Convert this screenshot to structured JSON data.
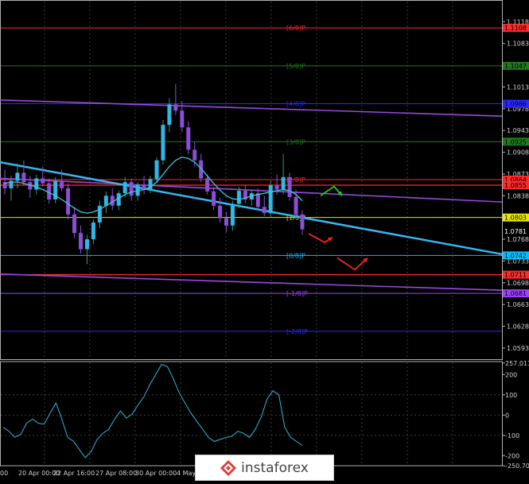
{
  "chart_data": [
    {
      "type": "candlestick",
      "ylim": [
        1.0575,
        1.1135
      ],
      "y_ticks": [
        "1.1118",
        "1.1083",
        "1.1048",
        "1.1013",
        "1.0978",
        "1.0943",
        "1.0908",
        "1.0873",
        "1.0838",
        "1.0803",
        "1.0768",
        "1.0733",
        "1.0698",
        "1.0663",
        "1.0628",
        "1.0593"
      ],
      "x_ticks": [
        "00",
        "20 Apr 00:00",
        "22 Apr 16:00",
        "27 Apr 08:00",
        "30 Apr 00:00",
        "4 May"
      ],
      "murray_levels": [
        {
          "label": "[6/8]P",
          "value": 1.1108,
          "tag": "1.1108",
          "color": "#ff2a2a"
        },
        {
          "label": "[5/8]P",
          "value": 1.1047,
          "tag": "1.1047",
          "color": "#1f7a1f"
        },
        {
          "label": "[4/8]P",
          "value": 1.0986,
          "tag": "1.0986",
          "color": "#2a2aff"
        },
        {
          "label": "[3/8]P",
          "value": 1.0925,
          "tag": "1.0925",
          "color": "#1f7a1f"
        },
        {
          "label": "[2/8]P",
          "value": 1.0864,
          "tag": "1.0864",
          "color": "#ff2a2a"
        },
        {
          "label": "[1/8]P",
          "value": 1.0803,
          "tag": "1.0803",
          "color": "#e8e800"
        },
        {
          "label": "[0/8]P",
          "value": 1.0742,
          "tag": "1.0742",
          "color": "#00bfff"
        },
        {
          "label": "[-1/8]P",
          "value": 1.0681,
          "tag": "1.0681",
          "color": "#a040ff"
        },
        {
          "label": "[-2/8]P",
          "value": 1.062,
          "tag": "",
          "color": "#2a2aff"
        }
      ],
      "price_tags": [
        {
          "value": 1.0855,
          "tag": "1.0855",
          "color": "#ff2a2a"
        },
        {
          "value": 1.0781,
          "tag": "1.0781",
          "color": "#ffffff"
        },
        {
          "value": 1.0711,
          "tag": "1.0711",
          "color": "#ff2a2a"
        }
      ],
      "current_price": 1.0781,
      "candles": [
        [
          1.086,
          1.088,
          1.084,
          1.085
        ],
        [
          1.085,
          1.087,
          1.083,
          1.0862
        ],
        [
          1.0862,
          1.089,
          1.085,
          1.0875
        ],
        [
          1.0875,
          1.0895,
          1.0855,
          1.086
        ],
        [
          1.086,
          1.087,
          1.0835,
          1.0848
        ],
        [
          1.0848,
          1.0872,
          1.084,
          1.0866
        ],
        [
          1.0866,
          1.0885,
          1.0852,
          1.0858
        ],
        [
          1.0858,
          1.0866,
          1.0825,
          1.0832
        ],
        [
          1.0832,
          1.0868,
          1.0826,
          1.0862
        ],
        [
          1.0862,
          1.088,
          1.0845,
          1.085
        ],
        [
          1.085,
          1.0858,
          1.08,
          1.0808
        ],
        [
          1.0808,
          1.082,
          1.077,
          1.0778
        ],
        [
          1.0778,
          1.079,
          1.0745,
          1.0752
        ],
        [
          1.0752,
          1.0775,
          1.0728,
          1.0768
        ],
        [
          1.0768,
          1.08,
          1.076,
          1.0795
        ],
        [
          1.0795,
          1.083,
          1.0786,
          1.0822
        ],
        [
          1.0822,
          1.0845,
          1.081,
          1.0838
        ],
        [
          1.0838,
          1.085,
          1.0815,
          1.0822
        ],
        [
          1.0822,
          1.0846,
          1.0815,
          1.0842
        ],
        [
          1.0842,
          1.0868,
          1.0835,
          1.086
        ],
        [
          1.086,
          1.0866,
          1.083,
          1.0838
        ],
        [
          1.0838,
          1.086,
          1.083,
          1.0856
        ],
        [
          1.0856,
          1.087,
          1.084,
          1.0848
        ],
        [
          1.0848,
          1.087,
          1.0842,
          1.0865
        ],
        [
          1.0865,
          1.09,
          1.0858,
          1.0895
        ],
        [
          1.0895,
          1.096,
          1.0888,
          1.0952
        ],
        [
          1.0952,
          1.0995,
          1.094,
          1.0985
        ],
        [
          1.0985,
          1.1018,
          1.0968,
          1.0975
        ],
        [
          1.0975,
          1.099,
          1.094,
          1.0948
        ],
        [
          1.0948,
          1.0958,
          1.0905,
          1.0912
        ],
        [
          1.0912,
          1.0925,
          1.0885,
          1.0895
        ],
        [
          1.0895,
          1.0905,
          1.086,
          1.0866
        ],
        [
          1.0866,
          1.0872,
          1.084,
          1.0845
        ],
        [
          1.0845,
          1.0852,
          1.0815,
          1.0822
        ],
        [
          1.0822,
          1.0835,
          1.0795,
          1.0802
        ],
        [
          1.0802,
          1.0812,
          1.078,
          1.079
        ],
        [
          1.079,
          1.083,
          1.0782,
          1.0825
        ],
        [
          1.0825,
          1.0852,
          1.0818,
          1.0846
        ],
        [
          1.0846,
          1.0856,
          1.0826,
          1.0832
        ],
        [
          1.0832,
          1.0848,
          1.0822,
          1.0842
        ],
        [
          1.0842,
          1.085,
          1.0815,
          1.082
        ],
        [
          1.082,
          1.0838,
          1.0805,
          1.081
        ],
        [
          1.081,
          1.0862,
          1.0805,
          1.0855
        ],
        [
          1.0855,
          1.0872,
          1.084,
          1.0848
        ],
        [
          1.0848,
          1.0905,
          1.084,
          1.0868
        ],
        [
          1.0868,
          1.0875,
          1.083,
          1.0836
        ],
        [
          1.0836,
          1.0848,
          1.08,
          1.0808
        ],
        [
          1.0808,
          1.0815,
          1.0775,
          1.0784
        ]
      ],
      "ma": [
        1.0858,
        1.086,
        1.086,
        1.0858,
        1.0855,
        1.0852,
        1.0848,
        1.0843,
        1.0838,
        1.0832,
        1.0825,
        1.0818,
        1.0812,
        1.081,
        1.0812,
        1.0816,
        1.0822,
        1.0828,
        1.0834,
        1.084,
        1.0844,
        1.0846,
        1.0848,
        1.0852,
        1.086,
        1.0872,
        1.0885,
        1.0895,
        1.09,
        1.0898,
        1.0892,
        1.0882,
        1.087,
        1.0858,
        1.0847,
        1.0838,
        1.0833,
        1.0832,
        1.0834,
        1.0838,
        1.084,
        1.0842,
        1.0844,
        1.0846,
        1.0848,
        1.0846,
        1.084,
        1.083
      ],
      "trend_lines": [
        {
          "name": "regression-upper",
          "color": "#9a48e0",
          "from": [
            0,
            1.0992
          ],
          "to": [
            631,
            1.0966
          ]
        },
        {
          "name": "regression-middle",
          "color": "#9a48e0",
          "from": [
            0,
            1.0866
          ],
          "to": [
            631,
            1.0828
          ]
        },
        {
          "name": "regression-lower",
          "color": "#9a48e0",
          "from": [
            0,
            1.0712
          ],
          "to": [
            631,
            1.0686
          ]
        },
        {
          "name": "trend-line",
          "color": "#35b7f0",
          "from": [
            0,
            1.0892
          ],
          "to": [
            631,
            1.0744
          ]
        }
      ],
      "forecast_arrows": [
        {
          "color": "#22d022",
          "points": [
            [
              403,
              1.0838
            ],
            [
              420,
              1.0853
            ],
            [
              430,
              1.0838
            ]
          ]
        },
        {
          "color": "#ff2020",
          "points": [
            [
              388,
              1.0777
            ],
            [
              408,
              1.0763
            ],
            [
              418,
              1.0771
            ]
          ]
        },
        {
          "color": "#ff2020",
          "points": [
            [
              424,
              1.0738
            ],
            [
              446,
              1.0719
            ],
            [
              462,
              1.0738
            ]
          ]
        }
      ]
    },
    {
      "type": "line",
      "name": "CCI",
      "ylim": [
        -250,
        260
      ],
      "y_ticks": [
        "257.0111",
        "200",
        "100",
        "0",
        "-100",
        "-200",
        "-250.7084"
      ],
      "values": [
        -60,
        -80,
        -110,
        -95,
        -40,
        -20,
        -40,
        -45,
        10,
        60,
        -20,
        -110,
        -130,
        -170,
        -210,
        -180,
        -120,
        -90,
        -70,
        -20,
        20,
        -15,
        5,
        50,
        90,
        150,
        200,
        250,
        240,
        180,
        110,
        60,
        10,
        -30,
        -70,
        -110,
        -130,
        -120,
        -110,
        -105,
        -80,
        -90,
        -110,
        -70,
        -10,
        80,
        120,
        100,
        -60,
        -110,
        -130,
        -150
      ]
    }
  ]
}
